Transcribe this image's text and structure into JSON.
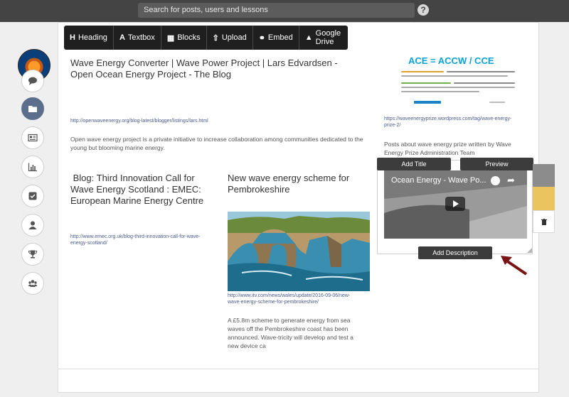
{
  "topbar": {
    "search_placeholder": "Search for posts, users and lessons",
    "help_label": "?"
  },
  "sidebar": {
    "items": [
      {
        "icon": "chat-icon"
      },
      {
        "icon": "folder-icon",
        "active": true
      },
      {
        "icon": "newspaper-icon"
      },
      {
        "icon": "chart-icon"
      },
      {
        "icon": "checkbox-icon"
      },
      {
        "icon": "user-icon"
      },
      {
        "icon": "trophy-icon"
      },
      {
        "icon": "users-icon"
      }
    ]
  },
  "toolbar": {
    "heading": "Heading",
    "textbox": "Textbox",
    "blocks": "Blocks",
    "upload": "Upload",
    "embed": "Embed",
    "gdrive": "Google Drive"
  },
  "posts": {
    "p1": {
      "title": "Wave Energy Converter | Wave Power Project | Lars Edvardsen - Open Ocean Energy Project - The Blog",
      "link": "http://openwaveenergy.org/blog-latest/blogger/listings/lars.html",
      "text": "Open wave energy project is a private initiative to increase collaboration among communities dedicated to the young but blooming marine energy."
    },
    "p2": {
      "title": " Blog: Third Innovation Call for Wave Energy Scotland : EMEC: European Marine Energy Centre",
      "link": "http://www.emec.org.uk/blog-third-innovation-call-for-wave-energy-scotland/"
    },
    "p3": {
      "title": "New wave energy scheme for Pembrokeshire",
      "link": "http://www.itv.com/news/wales/update/2016-09-06/new-wave-energy-scheme-for-pembrokeshire/",
      "text": "A £5.8m scheme to generate energy from sea waves off the Pembrokeshire coast has been announced. Wave-tricity will develop and test a new device ca"
    },
    "p4": {
      "ace_title": "ACE = ACCW / CCE",
      "link": "https://waveenergyprize.wordpress.com/tag/wave-energy-prize-2/",
      "text": "Posts about wave energy prize written by Wave Energy Prize Administration Team"
    }
  },
  "card": {
    "add_title": "Add Title",
    "preview": "Preview",
    "video_title": "Ocean Energy - Wave Po...",
    "add_description": "Add Description",
    "swatch_colors": [
      "#8c8c8c",
      "#e9c45f"
    ],
    "arrow_color": "#7a1414"
  }
}
